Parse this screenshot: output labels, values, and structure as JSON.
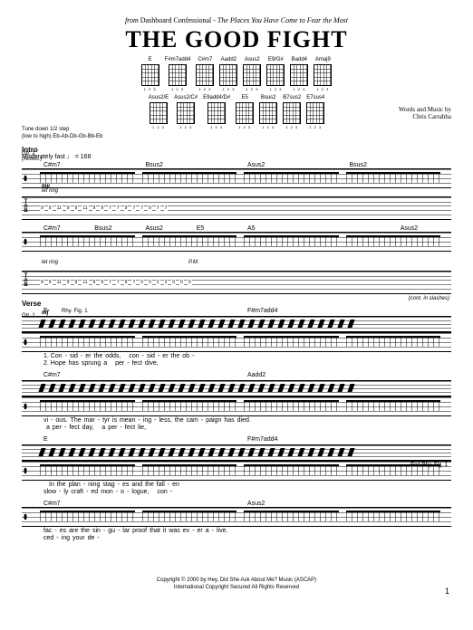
{
  "header": {
    "from_prefix": "from",
    "artist": "Dashboard Confessional",
    "album_sep": " - ",
    "album": "The Places You Have Come to Fear the Most",
    "title": "THE GOOD FIGHT",
    "credits_line1": "Words and Music by",
    "credits_line2": "Chris Carrabba"
  },
  "chord_diagrams": {
    "row1": [
      "E",
      "F#m7add4",
      "C#m7",
      "Aadd2",
      "Asus2",
      "E9/G#",
      "Badd4",
      "Amaj9"
    ],
    "row2": [
      "Asus2/E",
      "Asus2/C#",
      "E9add4/D#",
      "E5",
      "Bsus2",
      "B7sus2",
      "E7sus4"
    ],
    "fingers": "1 2 3"
  },
  "tuning": {
    "line1": "Tune down 1/2 step",
    "line2": "(low to high) Eb-Ab-Db-Gb-Bb-Eb"
  },
  "sections": {
    "intro": "Intro",
    "tempo": "Moderately fast ♩ = 168",
    "gtr1": "Gtr. 1",
    "gtr1_sub": "(Acous.)",
    "verse": "Verse",
    "dynamic_mp": "mp",
    "dynamic_mf": "mf",
    "technique": "let ring",
    "pm": "P.M.",
    "cont_slashes": "(cont. in slashes)",
    "rhy_fig": "Rhy. Fig. 1",
    "end_rhy_fig": "End Rhy. Fig. 1"
  },
  "intro_chords": {
    "line1": [
      "C#m7",
      "Bsus2",
      "Asus2",
      "Bsus2"
    ],
    "line2": [
      "C#m7",
      "Bsus2",
      "Asus2",
      "E5",
      "A5",
      "",
      "",
      "Asus2"
    ]
  },
  "verse_chords": {
    "line1": [
      "E",
      "",
      "F#m7add4",
      ""
    ],
    "line2": [
      "C#m7",
      "",
      "Aadd2",
      ""
    ],
    "line3": [
      "E",
      "",
      "F#m7add4",
      ""
    ],
    "line4": [
      "C#m7",
      "",
      "Asus2",
      ""
    ]
  },
  "lyrics": {
    "v1_l1": [
      "1. Con",
      "-",
      "sid",
      "-",
      "er",
      "the",
      "odds,",
      "",
      "",
      "con",
      "-",
      "sid",
      "-",
      "er",
      "the",
      "ob",
      "-"
    ],
    "v2_l1": [
      "2. Hope",
      "has",
      "sprung",
      "a",
      "",
      "",
      "per",
      "-",
      "fect",
      "dive,",
      "",
      "",
      "",
      "",
      ""
    ],
    "v1_l2": [
      "vi",
      "-",
      "ous.",
      "The",
      "mar",
      "-",
      "tyr",
      "is",
      "mean",
      "-",
      "ing",
      "-",
      "less,",
      "the",
      "cam",
      "-",
      "paign",
      "has",
      "died."
    ],
    "v2_l2": [
      "",
      "a",
      "per",
      "-",
      "fect",
      "day,",
      "",
      "",
      "a",
      "per",
      "-",
      "fect",
      "lie,",
      "",
      ""
    ],
    "v1_l3": [
      "",
      "",
      "In",
      "the",
      "plan",
      "-",
      "ning",
      "stag",
      "-",
      "es",
      "and",
      "the",
      "fall",
      "-",
      "en",
      ""
    ],
    "v2_l3": [
      "slow",
      "-",
      "ly",
      "craft",
      "-",
      "ed",
      "mon",
      "-",
      "o",
      "-",
      "logue,",
      "",
      "",
      "con",
      "-"
    ],
    "v1_l4": [
      "fac",
      "-",
      "es",
      "are",
      "the",
      "sin",
      "-",
      "gu",
      "-",
      "lar",
      "proof",
      "that",
      "it",
      "was",
      "ev",
      "-",
      "er",
      "a",
      "-",
      "live."
    ],
    "v2_l4": [
      "ced",
      "-",
      "ing",
      "your",
      "de",
      "-",
      "",
      "",
      "",
      "",
      "",
      "",
      "",
      "",
      "",
      ""
    ]
  },
  "tab_values": {
    "system1": [
      "9",
      "9",
      "11",
      "9",
      "9",
      "11",
      "9",
      "9",
      "7",
      "7",
      "9",
      "7",
      "7",
      "9",
      "7",
      "7"
    ],
    "system2": [
      "9",
      "9",
      "11",
      "9",
      "9",
      "11",
      "9",
      "9",
      "7",
      "7",
      "9",
      "7",
      "0",
      "0",
      "2",
      "2",
      "0",
      "0",
      "0"
    ]
  },
  "footer": {
    "copyright1": "Copyright © 2000 by Hey, Did She Ask About Me? Music (ASCAP)",
    "copyright2": "International Copyright Secured   All Rights Reserved",
    "page_num": "1"
  }
}
